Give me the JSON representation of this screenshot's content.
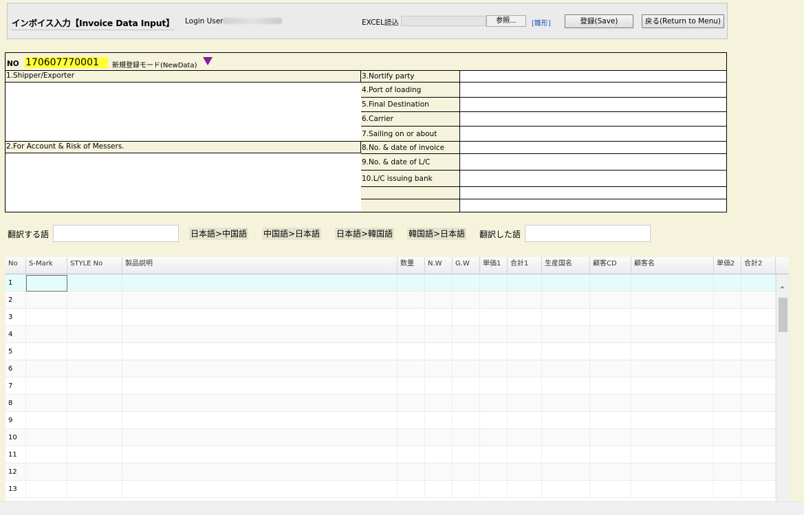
{
  "header": {
    "title": "インボイス入力【Invoice Data Input】",
    "login_label": "Login User",
    "excel_label": "EXCEL読込",
    "browse_label": "参照...",
    "template_link": "[雛形]",
    "save_label": "登録(Save)",
    "return_label": "戻る(Return to Menu)"
  },
  "record": {
    "no_label": "NO",
    "no_value": "170607770001",
    "mode_label": "新規登録モード(NewData)"
  },
  "form": {
    "shipper_label": "1.Shipper/Exporter",
    "account_label": "2.For Account & Risk of Messers.",
    "notify_label": "3.Nortify party",
    "port_label": "4.Port of loading",
    "destination_label": "5.Final Destination",
    "carrier_label": "6.Carrier",
    "sailing_label": "7.Sailing on or about",
    "invoice_label": "8.No. & date of invoice",
    "lc_label": "9.No. & date of L/C",
    "bank_label": "10.L/C issuing bank"
  },
  "translate": {
    "source_label": "翻訳する語",
    "ja_zh": "日本語>中国語",
    "zh_ja": "中国語>日本語",
    "ja_ko": "日本語>韓国語",
    "ko_ja": "韓国語>日本語",
    "result_label": "翻訳した語"
  },
  "grid": {
    "columns": [
      "No",
      "S-Mark",
      "STYLE No",
      "製品説明",
      "数量",
      "N.W",
      "G.W",
      "単価1",
      "合計1",
      "生産国名",
      "顧客CD",
      "顧客名",
      "単価2",
      "合計2"
    ],
    "rows": [
      "1",
      "2",
      "3",
      "4",
      "5",
      "6",
      "7",
      "8",
      "9",
      "10",
      "11",
      "12",
      "13"
    ]
  },
  "icons": {
    "mode_arrow": "triangle-down-icon",
    "scroll_up": "chevron-up-icon"
  },
  "colors": {
    "no_highlight": "#ffff33",
    "mode_arrow": "#8a1aa0",
    "active_row": "#e5fcfc",
    "background": "#f5f3dc"
  }
}
